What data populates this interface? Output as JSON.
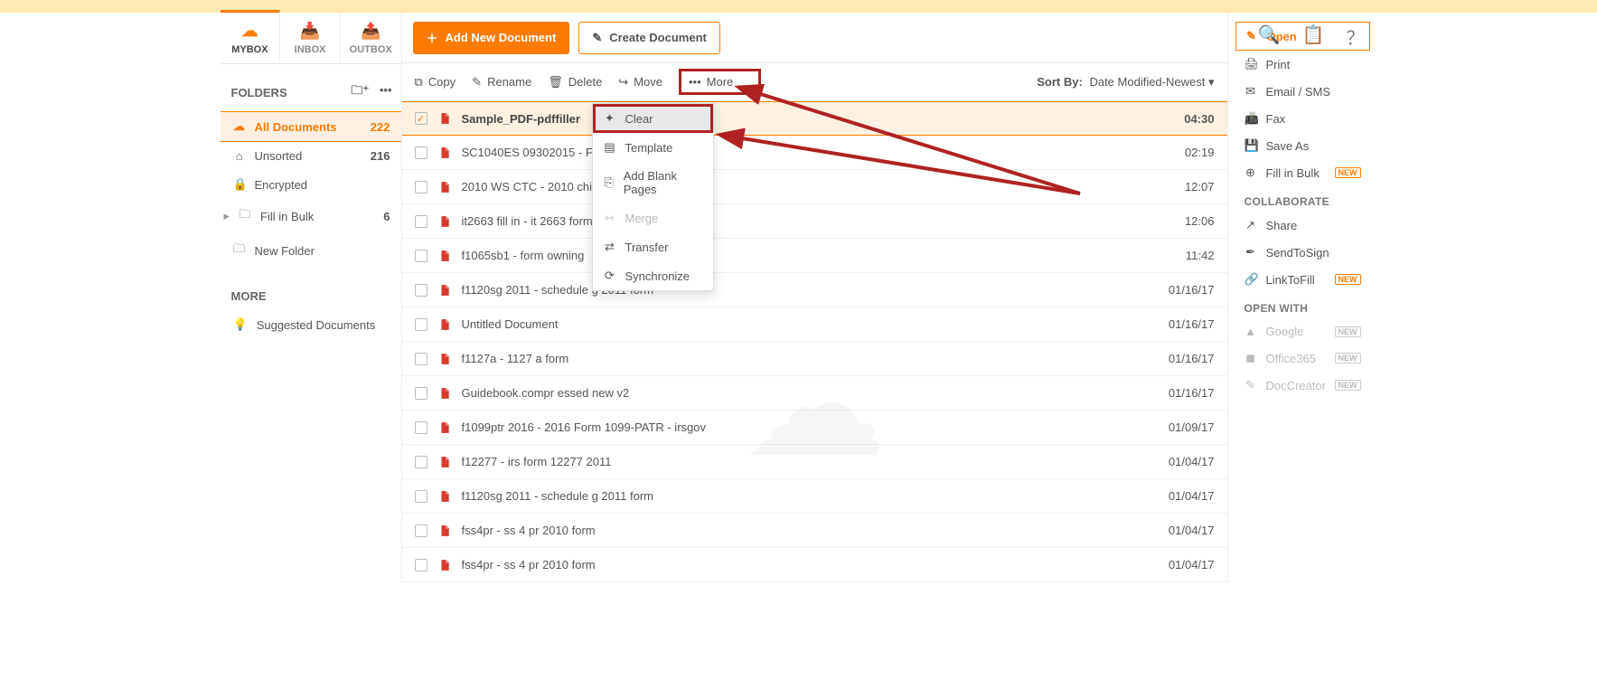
{
  "tabs": {
    "mybox": "MYBOX",
    "inbox": "INBOX",
    "outbox": "OUTBOX"
  },
  "buttons": {
    "add_new": "Add New Document",
    "create": "Create Document"
  },
  "folders_head": "FOLDERS",
  "folders": [
    {
      "label": "All Documents",
      "count": "222",
      "active": true
    },
    {
      "label": "Unsorted",
      "count": "216"
    },
    {
      "label": "Encrypted",
      "count": ""
    },
    {
      "label": "Fill in Bulk",
      "count": "6"
    },
    {
      "label": "New Folder",
      "count": ""
    }
  ],
  "more_head": "MORE",
  "more_items": [
    {
      "label": "Suggested Documents"
    }
  ],
  "toolbar": {
    "copy": "Copy",
    "rename": "Rename",
    "delete": "Delete",
    "move": "Move",
    "more": "More",
    "sortby_label": "Sort By:",
    "sortby_value": "Date Modified-Newest"
  },
  "dropdown": [
    {
      "label": "Clear",
      "hl": true
    },
    {
      "label": "Template"
    },
    {
      "label": "Add Blank Pages"
    },
    {
      "label": "Merge",
      "disabled": true
    },
    {
      "label": "Transfer"
    },
    {
      "label": "Synchronize"
    }
  ],
  "files": [
    {
      "name": "Sample_PDF-pdffiller",
      "time": "04:30",
      "selected": true
    },
    {
      "name": "SC1040ES 09302015 - FORM",
      "time": "02:19"
    },
    {
      "name": "2010 WS CTC - 2010 child tax",
      "time": "12:07"
    },
    {
      "name": "it2663 fill in - it 2663 form 201",
      "time": "12:06"
    },
    {
      "name": "f1065sb1 - form owning",
      "time": "11:42"
    },
    {
      "name": "f1120sg 2011 - schedule g 2011 form",
      "time": "01/16/17"
    },
    {
      "name": "Untitled Document",
      "time": "01/16/17"
    },
    {
      "name": "f1127a - 1127 a form",
      "time": "01/16/17"
    },
    {
      "name": "Guidebook.compr essed new v2",
      "time": "01/16/17"
    },
    {
      "name": "f1099ptr 2016 - 2016 Form 1099-PATR - irsgov",
      "time": "01/09/17"
    },
    {
      "name": "f12277 - irs form 12277 2011",
      "time": "01/04/17"
    },
    {
      "name": "f1120sg 2011 - schedule g 2011 form",
      "time": "01/04/17"
    },
    {
      "name": "fss4pr - ss 4 pr 2010 form",
      "time": "01/04/17"
    },
    {
      "name": "fss4pr - ss 4 pr 2010 form",
      "time": "01/04/17"
    }
  ],
  "right": {
    "open": "Open",
    "print": "Print",
    "email": "Email / SMS",
    "fax": "Fax",
    "saveas": "Save As",
    "fillbulk": "Fill in Bulk",
    "collab_head": "COLLABORATE",
    "share": "Share",
    "sendtosign": "SendToSign",
    "linktofill": "LinkToFill",
    "openwith_head": "OPEN WITH",
    "google": "Google",
    "office": "Office365",
    "doccreator": "DocCreator",
    "new": "NEW"
  }
}
